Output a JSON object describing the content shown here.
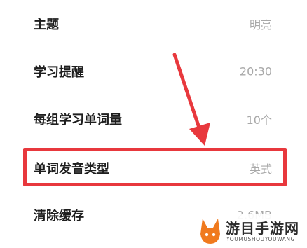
{
  "settings": [
    {
      "label": "主题",
      "value": "明亮"
    },
    {
      "label": "学习提醒",
      "value": "20:30"
    },
    {
      "label": "每组学习单词量",
      "value": "10个"
    },
    {
      "label": "单词发音类型",
      "value": "英式"
    },
    {
      "label": "清除缓存",
      "value": "2.6MB"
    }
  ],
  "annotation": {
    "highlight_color": "#e8383d",
    "highlighted_item": "单词发音类型"
  },
  "watermark": {
    "name": "游目手游网",
    "url": "YOUMUSHOUYOUWANG",
    "accent_color": "#f07a1e"
  }
}
